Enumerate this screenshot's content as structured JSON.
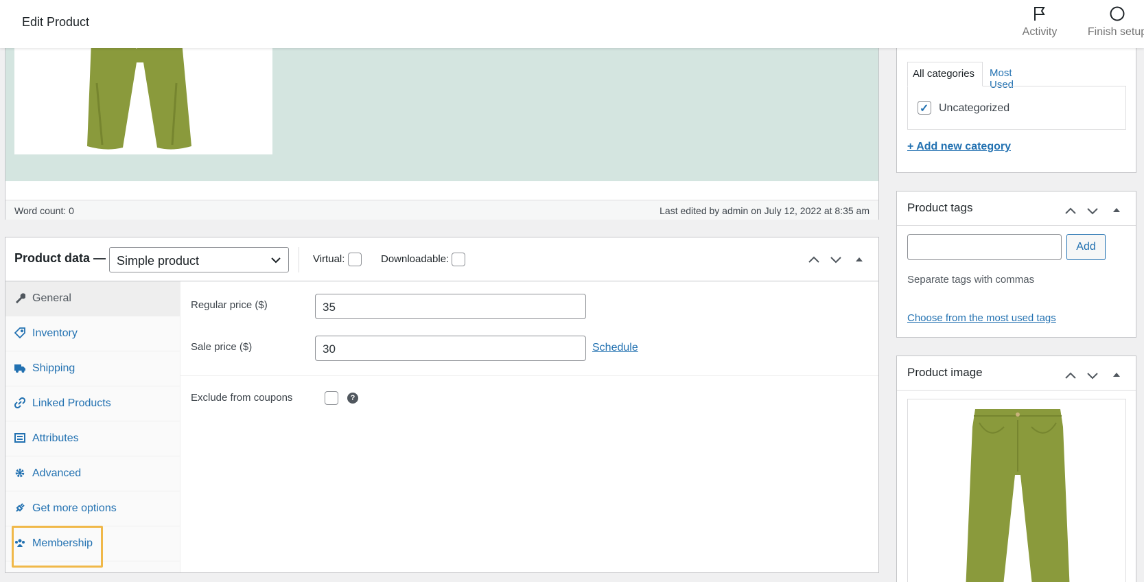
{
  "header": {
    "title": "Edit Product",
    "activity_label": "Activity",
    "finish_label": "Finish setup"
  },
  "editor": {
    "word_count": "Word count: 0",
    "last_edited": "Last edited by admin on July 12, 2022 at 8:35 am"
  },
  "product_data": {
    "title": "Product data —",
    "type_selected": "Simple product",
    "virtual_label": "Virtual:",
    "downloadable_label": "Downloadable:",
    "tabs": [
      {
        "label": "General",
        "icon": "wrench-icon"
      },
      {
        "label": "Inventory",
        "icon": "tag-icon"
      },
      {
        "label": "Shipping",
        "icon": "truck-icon"
      },
      {
        "label": "Linked Products",
        "icon": "link-icon"
      },
      {
        "label": "Attributes",
        "icon": "list-icon"
      },
      {
        "label": "Advanced",
        "icon": "gear-icon"
      },
      {
        "label": "Get more options",
        "icon": "plugin-icon"
      },
      {
        "label": "Membership",
        "icon": "groups-icon"
      }
    ],
    "general": {
      "regular_price_label": "Regular price ($)",
      "regular_price_value": "35",
      "sale_price_label": "Sale price ($)",
      "sale_price_value": "30",
      "schedule_label": "Schedule",
      "exclude_label": "Exclude from coupons",
      "help_glyph": "?"
    }
  },
  "categories": {
    "tab_all": "All categories",
    "tab_most_used": "Most Used",
    "item_label": "Uncategorized",
    "add_new": "+ Add new category"
  },
  "tags": {
    "title": "Product tags",
    "add_button": "Add",
    "hint": "Separate tags with commas",
    "choose_link": "Choose from the most used tags"
  },
  "product_image": {
    "title": "Product image"
  },
  "colors": {
    "accent": "#2271b1",
    "highlight": "#f0b849",
    "canvas_bg": "#d4e5e0",
    "product_green": "#8a9a3c"
  }
}
